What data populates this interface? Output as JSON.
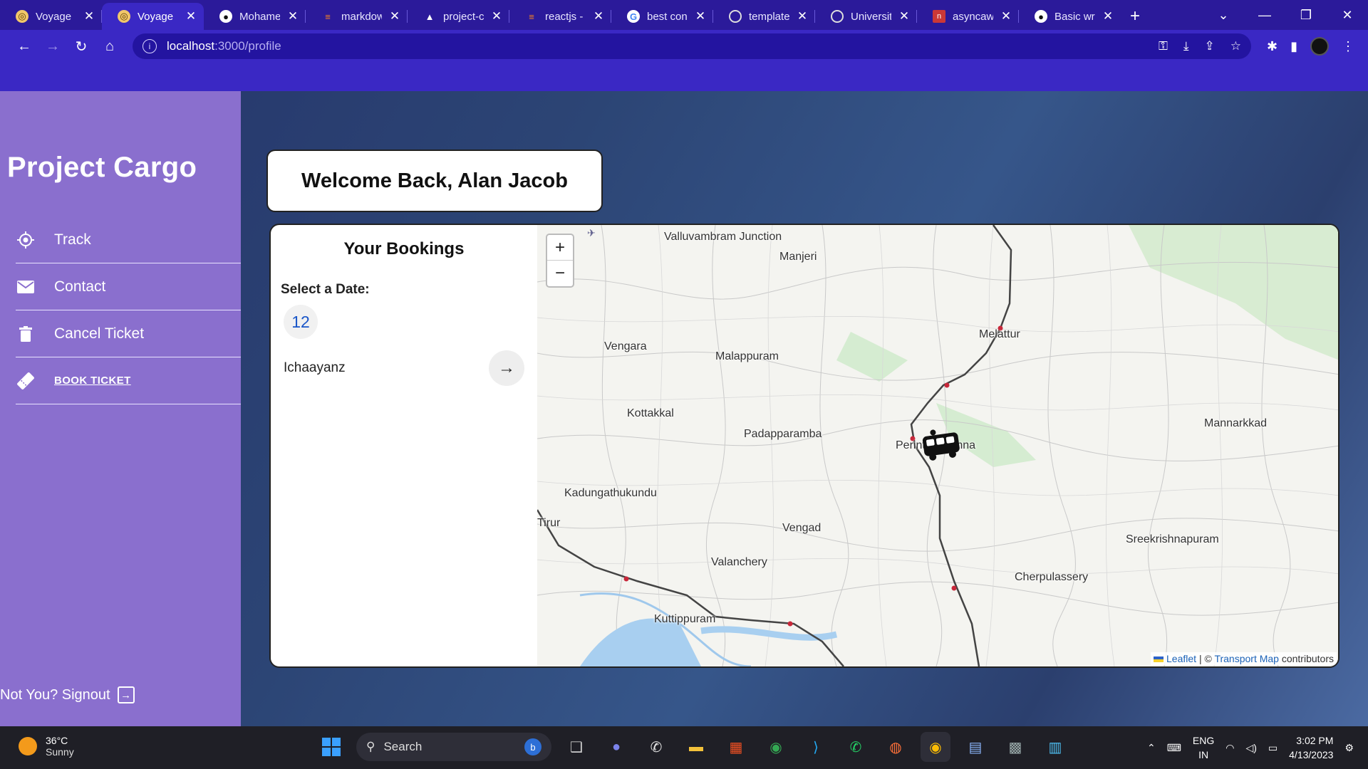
{
  "browser": {
    "tabs": [
      {
        "title": "Voyage",
        "icon": "voyage-icon",
        "active": false
      },
      {
        "title": "Voyage",
        "icon": "voyage-icon",
        "active": true
      },
      {
        "title": "Mohamec",
        "icon": "github-icon",
        "active": false
      },
      {
        "title": "markdow",
        "icon": "stackoverflow-icon",
        "active": false
      },
      {
        "title": "project-c",
        "icon": "vercel-icon",
        "active": false
      },
      {
        "title": "reactjs - /",
        "icon": "stackoverflow-icon",
        "active": false
      },
      {
        "title": "best cons",
        "icon": "google-icon",
        "active": false
      },
      {
        "title": "template",
        "icon": "globe-icon",
        "active": false
      },
      {
        "title": "University",
        "icon": "globe-icon",
        "active": false
      },
      {
        "title": "asyncawa",
        "icon": "npm-icon",
        "active": false
      },
      {
        "title": "Basic writ",
        "icon": "github-icon",
        "active": false
      }
    ],
    "new_tab": "+",
    "url_host": "localhost",
    "url_path": ":3000/profile"
  },
  "sidebar": {
    "brand": "Project Cargo",
    "items": [
      {
        "label": "Track",
        "icon": "target-icon"
      },
      {
        "label": "Contact",
        "icon": "mail-icon"
      },
      {
        "label": "Cancel Ticket",
        "icon": "trash-icon"
      },
      {
        "label": "BOOK TICKET",
        "icon": "ticket-icon"
      }
    ],
    "signout": "Not You? Signout"
  },
  "welcome": "Welcome Back, Alan Jacob",
  "bookings": {
    "title": "Your Bookings",
    "date_label": "Select a Date:",
    "date": "12",
    "name": "Ichaayanz"
  },
  "map": {
    "zoom_in": "+",
    "zoom_out": "−",
    "places": [
      "Valluvambram Junction",
      "Manjeri",
      "Melattur",
      "Vengara",
      "Malappuram",
      "Kottakkal",
      "Padapparamba",
      "Perinthalmanna",
      "Mannarkkad",
      "Kadungathukundu",
      "Tirur",
      "Vengad",
      "Sreekrishnapuram",
      "Valanchery",
      "Cherpulassery",
      "Kuttippuram"
    ],
    "attribution_leaflet": "Leaflet",
    "attribution_sep": " | © ",
    "attribution_provider": "Transport Map",
    "attribution_tail": " contributors"
  },
  "taskbar": {
    "temperature": "36°C",
    "condition": "Sunny",
    "search_placeholder": "Search",
    "lang_top": "ENG",
    "lang_bottom": "IN",
    "time": "3:02 PM",
    "date": "4/13/2023"
  }
}
